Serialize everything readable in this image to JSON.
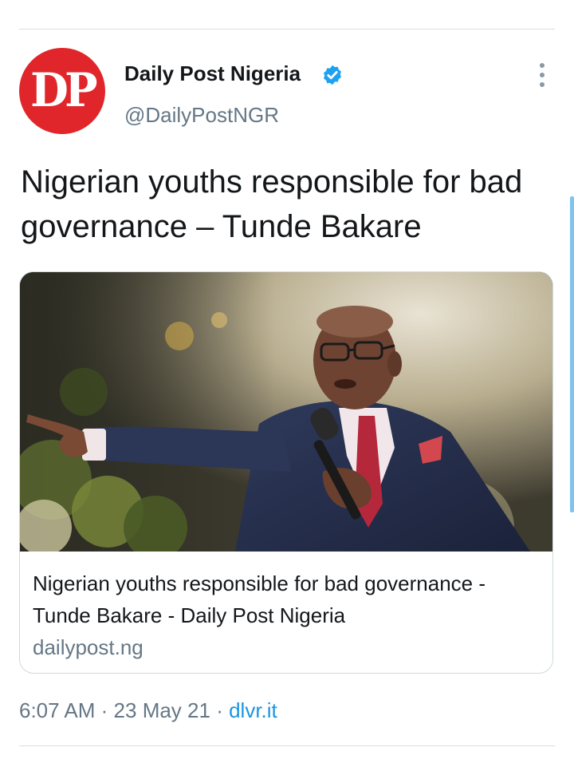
{
  "tweet": {
    "author": {
      "avatar_text": "DP",
      "name": "Daily Post Nigeria",
      "handle": "@DailyPostNGR",
      "verified_icon": "verified-badge-icon"
    },
    "more_icon": "more-vertical-icon",
    "text": "Nigerian youths responsible for bad governance – Tunde Bakare",
    "card": {
      "image_description_icon": "article-photo",
      "title": "Nigerian youths responsible for bad governance - Tunde Bakare - Daily Post Nigeria",
      "domain": "dailypost.ng"
    },
    "meta": {
      "time": "6:07 AM",
      "separator": "·",
      "date": "23 May 21",
      "source": "dlvr.it"
    }
  },
  "colors": {
    "avatar_red": "#e0262b",
    "verified_blue": "#1da1f2",
    "link_blue": "#1b95e0",
    "secondary_text": "#657786",
    "primary_text": "#14171a"
  }
}
